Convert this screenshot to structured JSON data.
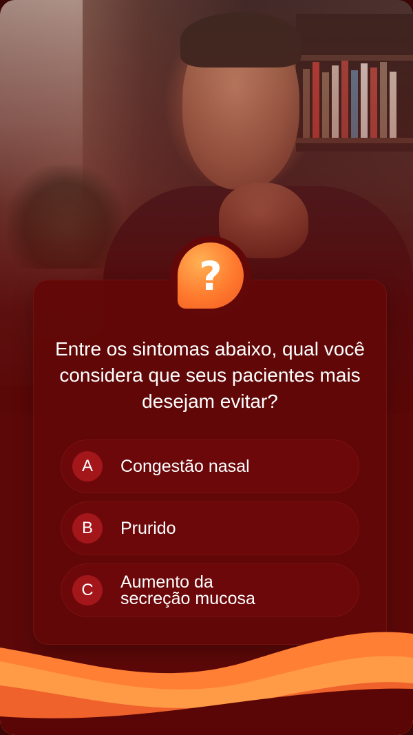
{
  "quiz": {
    "badge_symbol": "?",
    "question": "Entre os sintomas abaixo, qual você considera que seus pacientes mais desejam evitar?",
    "options": [
      {
        "letter": "A",
        "label": "Congestão nasal"
      },
      {
        "letter": "B",
        "label": "Prurido"
      },
      {
        "letter": "C",
        "label": "Aumento da secreção mucosa"
      }
    ]
  },
  "colors": {
    "background": "#5d0808",
    "card": "#620808",
    "accent_orange": "#ff7a2e",
    "letter_circle": "#a3161a",
    "text": "#ffffff"
  },
  "icons": {
    "badge": "question-bubble-icon"
  }
}
